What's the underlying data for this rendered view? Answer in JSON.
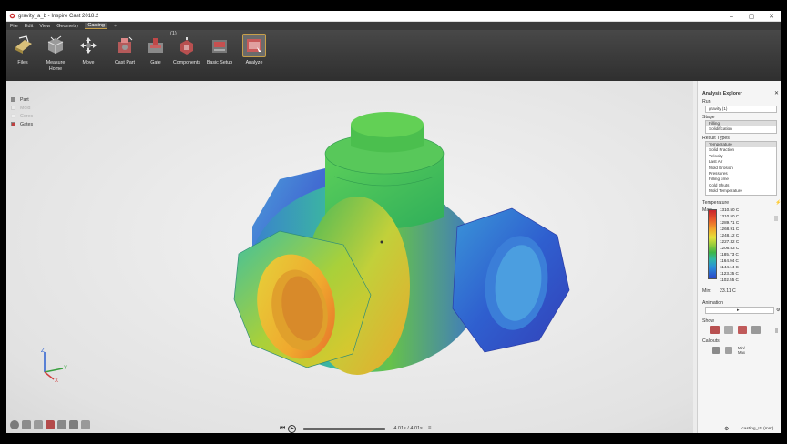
{
  "window": {
    "title": "gravity_a_b - Inspire Cast 2018.2",
    "minimize": "–",
    "maximize": "▢",
    "close": "✕"
  },
  "menu": {
    "items": [
      "File",
      "Edit",
      "View",
      "Geometry",
      "Casting"
    ],
    "add": "+"
  },
  "ribbon": {
    "badge": "(1)",
    "buttons": [
      {
        "label": "Files",
        "icon": "files-icon"
      },
      {
        "label": "Measure\nHome",
        "icon": "measure-icon"
      },
      {
        "label": "Move",
        "icon": "move-icon"
      },
      {
        "label": "Cast Part",
        "icon": "cast-part-icon"
      },
      {
        "label": "Gate",
        "icon": "gate-icon"
      },
      {
        "label": "Components",
        "icon": "components-icon"
      },
      {
        "label": "Basic Setup",
        "icon": "basic-setup-icon"
      },
      {
        "label": "Analyze",
        "icon": "analyze-icon"
      }
    ]
  },
  "model_legend": [
    {
      "label": "Part",
      "color": "#8a8a8a",
      "dim": false
    },
    {
      "label": "Mold",
      "color": "#cfcfcf",
      "dim": true
    },
    {
      "label": "Cores",
      "color": "#dcdcdc",
      "dim": true
    },
    {
      "label": "Gates",
      "color": "#c04040",
      "dim": false
    }
  ],
  "panel": {
    "title": "Analysis Explorer",
    "run_label": "Run",
    "run_value": "gravity (1)",
    "stage_label": "Stage",
    "stages": [
      "Filling",
      "Solidification"
    ],
    "stage_selected": 0,
    "result_types_label": "Result Types",
    "result_types": [
      "Temperature",
      "Solid Fraction",
      "Velocity",
      "Last Air",
      "Mold Erosion",
      "Pressures",
      "Filling time",
      "Cold Shuts",
      "Mold Temperature"
    ],
    "result_selected": 0,
    "scale_label": "Temperature",
    "scale_max_label": "Max:",
    "scale_values": [
      "1310.50 C",
      "1310.50 C",
      "1289.71 C",
      "1268.91 C",
      "1248.12 C",
      "1227.32 C",
      "1206.53 C",
      "1185.73 C",
      "1164.94 C",
      "1144.14 C",
      "1123.35 C",
      "1102.55 C"
    ],
    "scale_min_label": "Min:",
    "scale_min_value": "23.11 C",
    "animation_label": "Animation",
    "show_label": "Show",
    "callouts_label": "Callouts",
    "callout_minmax": "Min/\nMax"
  },
  "timeline": {
    "time": "4.01s / 4.01s",
    "progress": 1.0
  },
  "status": {
    "units": "casting_IS (mm)"
  },
  "colors": {
    "accent": "#c8a04a",
    "ribbon": "#3a3a3a",
    "panel": "#f5f5f5"
  }
}
